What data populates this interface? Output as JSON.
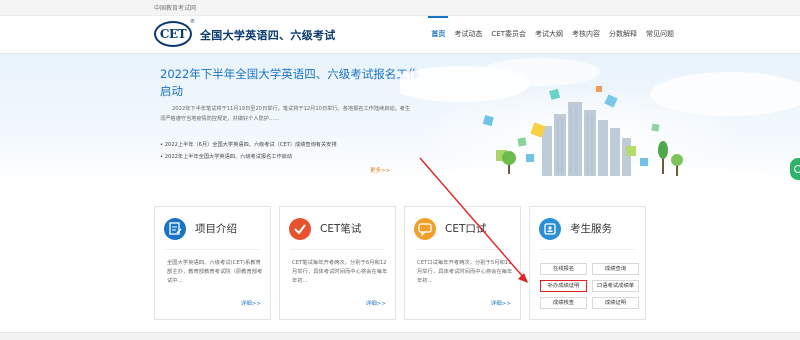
{
  "topbar": {
    "site_name": "中国教育考试网"
  },
  "header": {
    "logo_text": "CET",
    "logo_mark": "®",
    "brand": "全国大学英语四、六级考试",
    "nav": [
      {
        "label": "首页",
        "active": true
      },
      {
        "label": "考试动态",
        "active": false
      },
      {
        "label": "CET委员会",
        "active": false
      },
      {
        "label": "考试大纲",
        "active": false
      },
      {
        "label": "考核内容",
        "active": false
      },
      {
        "label": "分数解释",
        "active": false
      },
      {
        "label": "常见问题",
        "active": false
      }
    ]
  },
  "hero": {
    "title": "2022年下半年全国大学英语四、六级考试报名工作启动",
    "summary": "2022年下半年笔试将于11月19日至20日举行，笔试将于12月10日举行。各地报名工作陆续启动。考生须严格遵守当地疫情防控规定，并做好个人防护……",
    "news": [
      "2022上半年（6月）全国大学英语四、六级考试（CET）成绩查询有关安排",
      "2022年上半年全国大学英语四、六级考试报名工作启动"
    ],
    "more_label": "更多>>"
  },
  "cards": [
    {
      "title": "项目介绍",
      "icon": "edit-document-icon",
      "desc": "全国大学英语四、六级考试(CET)系教育部主办，教育部教育考试院（原教育部考试中...",
      "detail_label": "详细>>"
    },
    {
      "title": "CET笔试",
      "icon": "checkmark-icon",
      "desc": "CET笔试每年开考两次，分别于6月和12月举行，具体考试时间而中心将会在每年年初...",
      "detail_label": "详细>>"
    },
    {
      "title": "CET口试",
      "icon": "speech-bubble-icon",
      "desc": "CET口试每年开考两次，分别于5月和11月举行，具体考试时间而中心将会在每年年初...",
      "detail_label": "详细>>"
    },
    {
      "title": "考生服务",
      "icon": "id-card-icon",
      "services": [
        {
          "label": "在线报名",
          "highlighted": false
        },
        {
          "label": "成绩查询",
          "highlighted": false
        },
        {
          "label": "补办成绩证明",
          "highlighted": true
        },
        {
          "label": "口语考试成绩单",
          "highlighted": false
        },
        {
          "label": "成绩核查",
          "highlighted": false
        },
        {
          "label": "成绩证明",
          "highlighted": false
        }
      ]
    }
  ],
  "colors": {
    "brand_blue": "#0a3a6e",
    "accent_blue": "#1a73c6",
    "highlight_red": "#e02424",
    "more_orange": "#e67e22"
  }
}
